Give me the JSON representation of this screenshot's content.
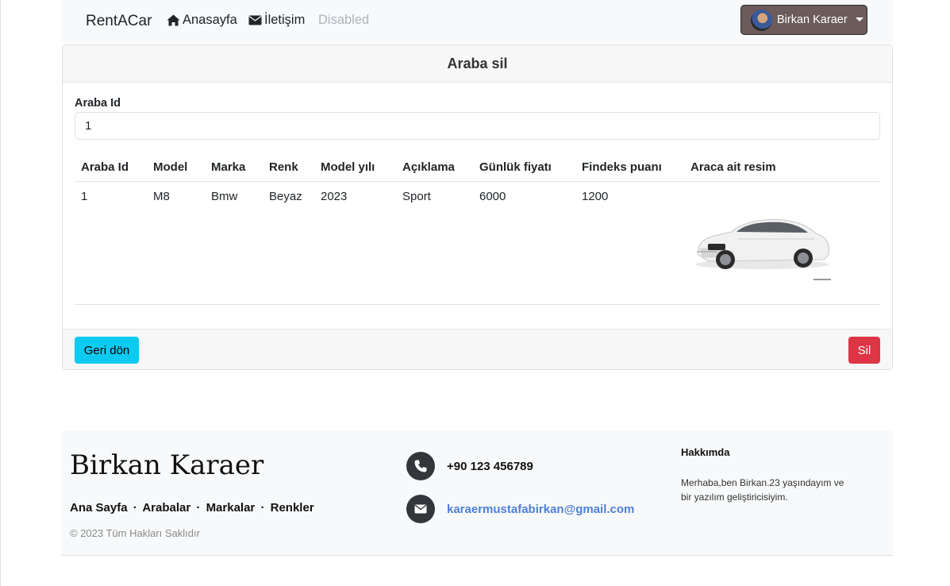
{
  "navbar": {
    "brand": "RentACar",
    "links": [
      {
        "label": "Anasayfa",
        "icon": "home-icon"
      },
      {
        "label": "İletişim",
        "icon": "envelope-icon"
      },
      {
        "label": "Disabled"
      }
    ],
    "user": {
      "name": "Birkan Karaer"
    }
  },
  "card": {
    "title": "Araba sil",
    "field_label": "Araba Id",
    "field_value": "1",
    "table": {
      "headers": [
        "Araba Id",
        "Model",
        "Marka",
        "Renk",
        "Model yılı",
        "Açıklama",
        "Günlük fiyatı",
        "Findeks puanı",
        "Araca ait resim"
      ],
      "rows": [
        {
          "id": "1",
          "model": "M8",
          "brand": "Bmw",
          "color": "Beyaz",
          "year": "2023",
          "description": "Sport",
          "daily_price": "6000",
          "findeks": "1200"
        }
      ]
    },
    "back_button": "Geri dön",
    "delete_button": "Sil"
  },
  "footer": {
    "name": "Birkan Karaer",
    "links": [
      "Ana Sayfa",
      "Arabalar",
      "Markalar",
      "Renkler"
    ],
    "separator": "·",
    "copyright": "© 2023 Tüm Hakları Saklıdır",
    "phone": "+90 123 456789",
    "email": "karaermustafabirkan@gmail.com",
    "about_title": "Hakkımda",
    "about_text": "Merhaba,ben Birkan.23 yaşındayım ve bir yazılım geliştiricisiyim."
  },
  "colors": {
    "info_button": "#0dcaf0",
    "danger_button": "#dc3545",
    "user_button": "#6c5b5b",
    "link": "#4d7fd6"
  }
}
